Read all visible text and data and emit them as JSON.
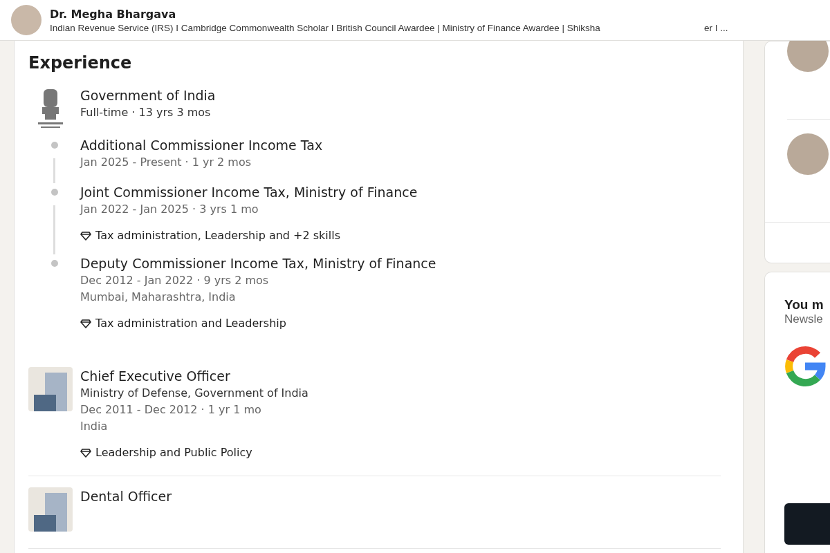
{
  "header": {
    "name": "Dr. Megha Bhargava",
    "headline": "Indian Revenue Service (IRS) I Cambridge Commonwealth Scholar I British Council Awardee | Ministry of Finance Awardee | Shiksha",
    "headline_tail": "er I ..."
  },
  "experience": {
    "title": "Experience",
    "entries": [
      {
        "kind": "group",
        "company": "Government of India",
        "meta": "Full-time · 13 yrs 3 mos",
        "roles": [
          {
            "title": "Additional Commissioner Income Tax",
            "dates": "Jan 2025 - Present · 1 yr 2 mos"
          },
          {
            "title": "Joint Commissioner Income Tax, Ministry of Finance",
            "dates": "Jan 2022 - Jan 2025 · 3 yrs 1 mo",
            "skills": "Tax administration, Leadership and +2 skills"
          },
          {
            "title": "Deputy Commissioner Income Tax, Ministry of Finance",
            "dates": "Dec 2012 - Jan 2022 · 9 yrs 2 mos",
            "location": "Mumbai, Maharashtra, India",
            "skills": "Tax administration and Leadership"
          }
        ]
      },
      {
        "kind": "single",
        "title": "Chief Executive Officer",
        "company": "Ministry of Defense, Government of India",
        "dates": "Dec 2011 - Dec 2012 · 1 yr 1 mo",
        "location": "India",
        "skills": "Leadership and Public Policy"
      },
      {
        "kind": "single",
        "title": "Dental Officer"
      }
    ]
  },
  "sidebar": {
    "suggestion_title": "You m",
    "suggestion_subtitle": "Newsle"
  }
}
